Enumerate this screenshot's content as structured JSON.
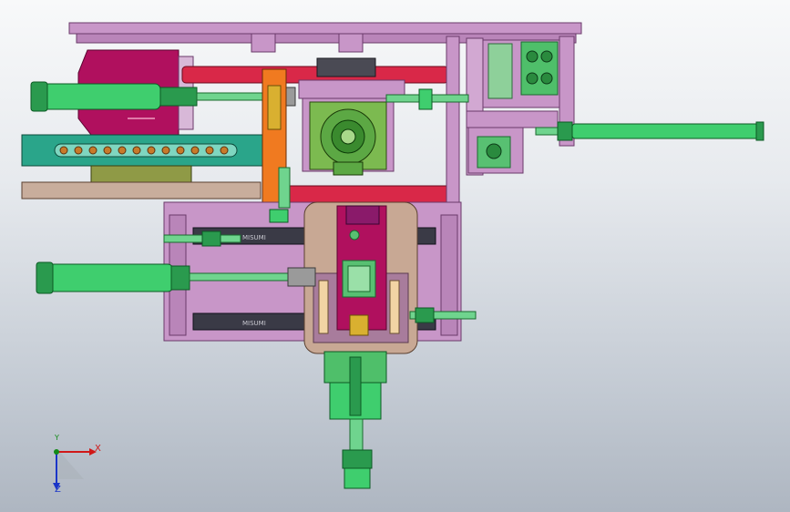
{
  "window": {
    "width": 867,
    "height": 562
  },
  "viewport": {
    "background_top": "#f8f9fa",
    "background_bottom": "#aeb6c1",
    "content": "cad-assembly-top-view"
  },
  "triad": {
    "x_label": "X",
    "y_label": "Y",
    "z_label": "Z",
    "x_color": "#d01818",
    "y_color": "#128a18",
    "z_color": "#1a35c8"
  },
  "part_labels": {
    "rail_upper": "MISUMI",
    "rail_lower": "MISUMI"
  },
  "palette": {
    "frame": "#c896c8",
    "frame_dark": "#8a4e8a",
    "magenta": "#b0105e",
    "cylinder_green": "#3fce6e",
    "cylinder_dark": "#168a3c",
    "red_rod": "#d92848",
    "teal_plate": "#2aa58a",
    "olive": "#8f9a46",
    "tan": "#f2d4a4",
    "beige_plate": "#c8ad9c",
    "orange": "#f07a20"
  }
}
